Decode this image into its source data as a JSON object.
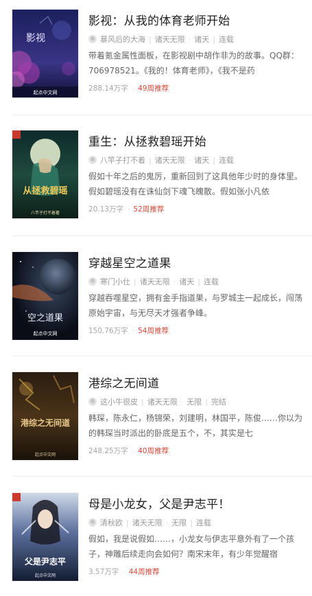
{
  "books": [
    {
      "title": "影视：从我的体育老师开始",
      "author": "暴风后的大海",
      "category": "诸天无限",
      "subcategory": "诸天",
      "status": "连载",
      "description": "带着氪金属性面板，在影视剧中胡作非为的故事。QQ群：706978521。《我的！体育老师》，《我不是药",
      "word_count": "288.14万字",
      "weeks": "49周推荐",
      "cover": {
        "title_text": "影视",
        "publisher": "起点中文网",
        "theme": "purple-blossom"
      }
    },
    {
      "title": "重生：从拯救碧瑶开始",
      "author": "八竿子打不着",
      "category": "诸天无限",
      "subcategory": "诸天",
      "status": "连载",
      "description": "假如十年之后的鬼厉，重新回到了这具他年少时的身体里。假如碧瑶没有在诛仙剑下魂飞魄散。假如张小凡依",
      "word_count": "20.13万字",
      "weeks": "52周推荐",
      "cover": {
        "title_text": "从拯救碧瑶",
        "publisher": "八竿子打不着著",
        "theme": "moon-green"
      }
    },
    {
      "title": "穿越星空之道果",
      "author": "寒门小仕",
      "category": "诸天无限",
      "subcategory": "诸天",
      "status": "连载",
      "description": "穿越吞噬星空，拥有金手指道果，与罗城主一起成长，闯荡原始宇宙，与无尽天才强者争峰。",
      "word_count": "150.76万字",
      "weeks": "54周推荐",
      "cover": {
        "title_text": "空之道果",
        "publisher": "起点中文网",
        "theme": "planet-space"
      }
    },
    {
      "title": "港综之无间道",
      "author": "这小牛很皮",
      "category": "诸天无限",
      "subcategory": "无限",
      "status": "完结",
      "description": "韩琛，陈永仁，杨锦荣，刘建明，林国平，陈俊……你以为的韩琛当时派出的卧底是五个，不，其实是七",
      "word_count": "248.25万字",
      "weeks": "40周推荐",
      "cover": {
        "title_text": "港综之无间道",
        "publisher": "起点中文网",
        "theme": "gold-dark"
      }
    },
    {
      "title": "母是小龙女，父是尹志平！",
      "author": "清秋欧",
      "category": "诸天无限",
      "subcategory": "无限",
      "status": "连载",
      "description": "假如，我是说假如……，小龙女与伊志平意外有了一个孩子，神雕后续走向会如何？南宋末年，有少年觉醒宿",
      "word_count": "3.57万字",
      "weeks": "44周推荐",
      "cover": {
        "title_text": "父是尹志平",
        "publisher": "起点中文网",
        "theme": "hero-blue"
      }
    }
  ],
  "colors": {
    "title": "#222222",
    "meta": "#999999",
    "desc": "#666666",
    "recommend": "#d24a3a",
    "divider": "#ececec"
  }
}
